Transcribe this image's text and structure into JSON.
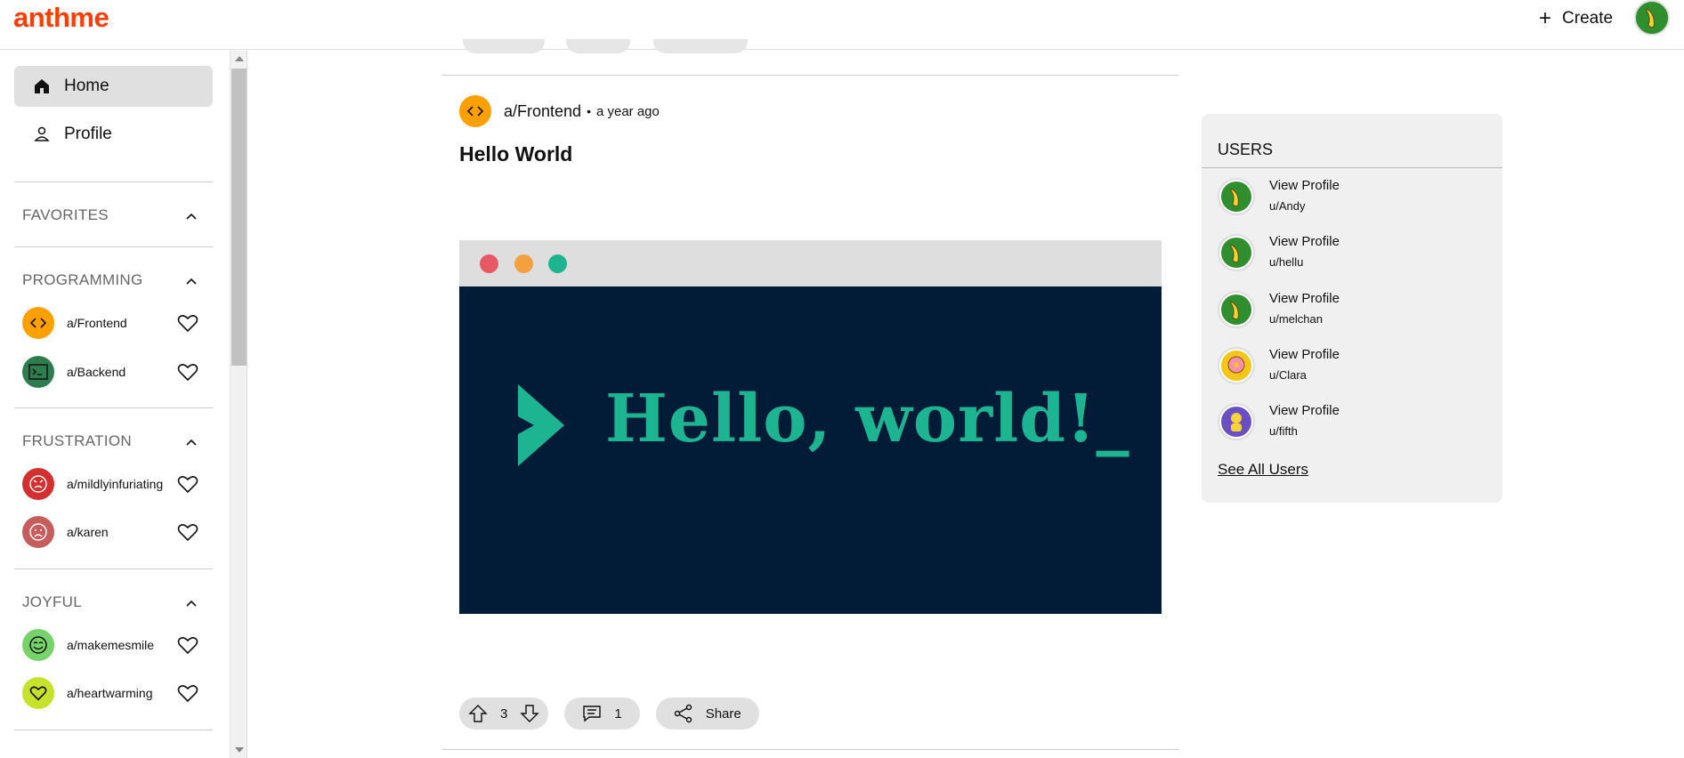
{
  "header": {
    "logo": "anthme",
    "create_label": "Create",
    "avatar_icon": "banana-avatar-icon"
  },
  "sidebar": {
    "nav": [
      {
        "label": "Home",
        "icon": "home-icon",
        "active": true
      },
      {
        "label": "Profile",
        "icon": "person-icon",
        "active": false
      }
    ],
    "sections": [
      {
        "title": "FAVORITES",
        "communities": []
      },
      {
        "title": "PROGRAMMING",
        "communities": [
          {
            "name": "a/Frontend",
            "icon": "code-icon",
            "color": "#ffa000"
          },
          {
            "name": "a/Backend",
            "icon": "terminal-icon",
            "color": "#2e7d4f"
          }
        ]
      },
      {
        "title": "FRUSTRATION",
        "communities": [
          {
            "name": "a/mildlyinfuriating",
            "icon": "angry-face-icon",
            "color": "#d32f2f"
          },
          {
            "name": "a/karen",
            "icon": "sad-face-icon",
            "color": "#c75c5c"
          }
        ]
      },
      {
        "title": "JOYFUL",
        "communities": [
          {
            "name": "a/makemesmile",
            "icon": "smile-face-icon",
            "color": "#76d36a"
          },
          {
            "name": "a/heartwarming",
            "icon": "heart-icon",
            "color": "#c6e22a"
          }
        ]
      }
    ]
  },
  "post": {
    "community": "a/Frontend",
    "separator": "•",
    "time": "a year ago",
    "title": "Hello World",
    "image_text": "Hello, world!_",
    "upvotes": "3",
    "comments": "1",
    "share_label": "Share"
  },
  "users_panel": {
    "title": "USERS",
    "users": [
      {
        "link": "View Profile",
        "name": "u/Andy",
        "avatar_color": "#2f8f2f"
      },
      {
        "link": "View Profile",
        "name": "u/hellu",
        "avatar_color": "#2f8f2f"
      },
      {
        "link": "View Profile",
        "name": "u/melchan",
        "avatar_color": "#2f8f2f"
      },
      {
        "link": "View Profile",
        "name": "u/Clara",
        "avatar_color": "#f5c518"
      },
      {
        "link": "View Profile",
        "name": "u/fifth",
        "avatar_color": "#6a4fc4"
      }
    ],
    "see_all": "See All Users"
  },
  "colors": {
    "brand": "#ff3d00",
    "hello_world_green": "#1db591",
    "hello_world_bg": "#021c38"
  }
}
